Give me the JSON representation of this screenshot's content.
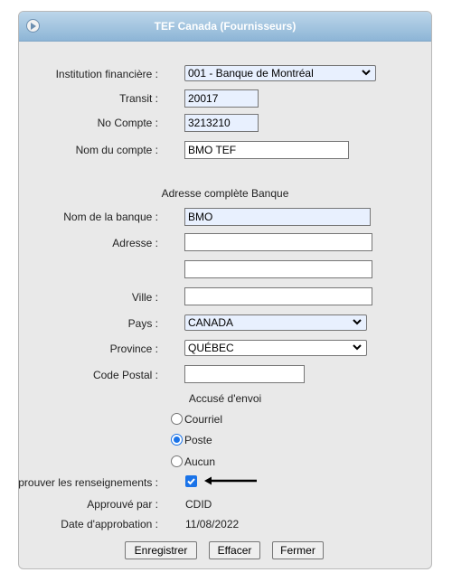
{
  "window": {
    "title": "TEF Canada (Fournisseurs)"
  },
  "form": {
    "institution": {
      "label": "Institution financière :",
      "value": "001 - Banque de Montréal"
    },
    "transit": {
      "label": "Transit :",
      "value": "20017"
    },
    "no_compte": {
      "label": "No Compte :",
      "value": "3213210"
    },
    "nom_compte": {
      "label": "Nom du compte :",
      "value": "BMO TEF"
    },
    "section_title": "Adresse complète Banque",
    "nom_banque": {
      "label": "Nom de la banque :",
      "value": "BMO"
    },
    "adresse": {
      "label": "Adresse :",
      "value1": "",
      "value2": ""
    },
    "ville": {
      "label": "Ville :",
      "value": ""
    },
    "pays": {
      "label": "Pays :",
      "value": "CANADA"
    },
    "province": {
      "label": "Province :",
      "value": "QUÉBEC"
    },
    "code_postal": {
      "label": "Code Postal :",
      "value": ""
    },
    "accuse": {
      "title": "Accusé d'envoi",
      "options": [
        "Courriel",
        "Poste",
        "Aucun"
      ],
      "selected": "Poste"
    },
    "approuver": {
      "label": "Approuver les renseignements :",
      "checked": true
    },
    "approuve_par": {
      "label": "Approuvé par :",
      "value": "CDID"
    },
    "date_approbation": {
      "label": "Date d'approbation :",
      "value": "11/08/2022"
    }
  },
  "buttons": {
    "save": "Enregistrer",
    "clear": "Effacer",
    "close": "Fermer"
  },
  "colors": {
    "titlebar": "#9cc0dd",
    "panel": "#e9e9e9",
    "autofill": "#e8f0fe",
    "accent": "#1a73e8"
  }
}
